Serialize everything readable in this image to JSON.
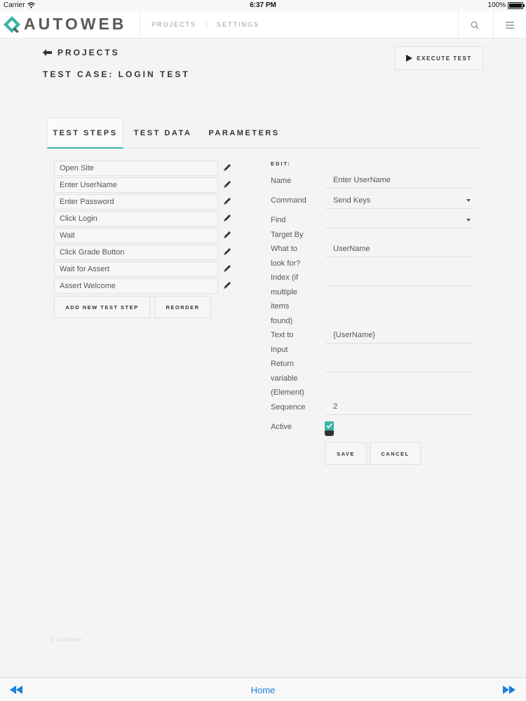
{
  "status_bar": {
    "carrier": "Carrier",
    "time": "6:37 PM",
    "battery": "100%"
  },
  "header": {
    "logo": "AUTOWEB",
    "nav": [
      "PROJECTS",
      "SETTINGS"
    ],
    "icons": [
      "search-icon",
      "menu-icon"
    ]
  },
  "page": {
    "back_label": "PROJECTS",
    "title": "TEST CASE: LOGIN TEST",
    "execute_label": "EXECUTE TEST"
  },
  "tabs": [
    "TEST STEPS",
    "TEST DATA",
    "PARAMETERS"
  ],
  "active_tab": "TEST STEPS",
  "steps": [
    "Open Site",
    "Enter UserName",
    "Enter Password",
    "Click Login",
    "Wait",
    "Click Grade Button",
    "Wait for Assert",
    "Assert Welcome"
  ],
  "step_buttons": {
    "add": "ADD NEW TEST STEP",
    "reorder": "REORDER"
  },
  "edit": {
    "heading": "EDIT:",
    "name_label": "Name",
    "name_value": "Enter UserName",
    "command_label": "Command",
    "command_value": "Send Keys",
    "find_label": [
      "Find",
      "Target By"
    ],
    "find_value": "",
    "what_label": [
      "What to",
      "look for?"
    ],
    "what_value": "UserName",
    "index_label": [
      "Index (if",
      "multiple",
      "items",
      "found)"
    ],
    "index_value": "",
    "text_label": [
      "Text to",
      "Input"
    ],
    "text_value": "{UserName}",
    "return_label": [
      "Return",
      "variable",
      "(Element)"
    ],
    "return_value": "",
    "sequence_label": "Sequence",
    "sequence_value": "2",
    "active_label": "Active",
    "active_checked": true,
    "save_label": "SAVE",
    "cancel_label": "CANCEL"
  },
  "footer_note": "© AUTOWEB",
  "toolbar": {
    "home": "Home"
  },
  "colors": {
    "accent": "#3ab5a6",
    "link": "#1a7fe0"
  }
}
